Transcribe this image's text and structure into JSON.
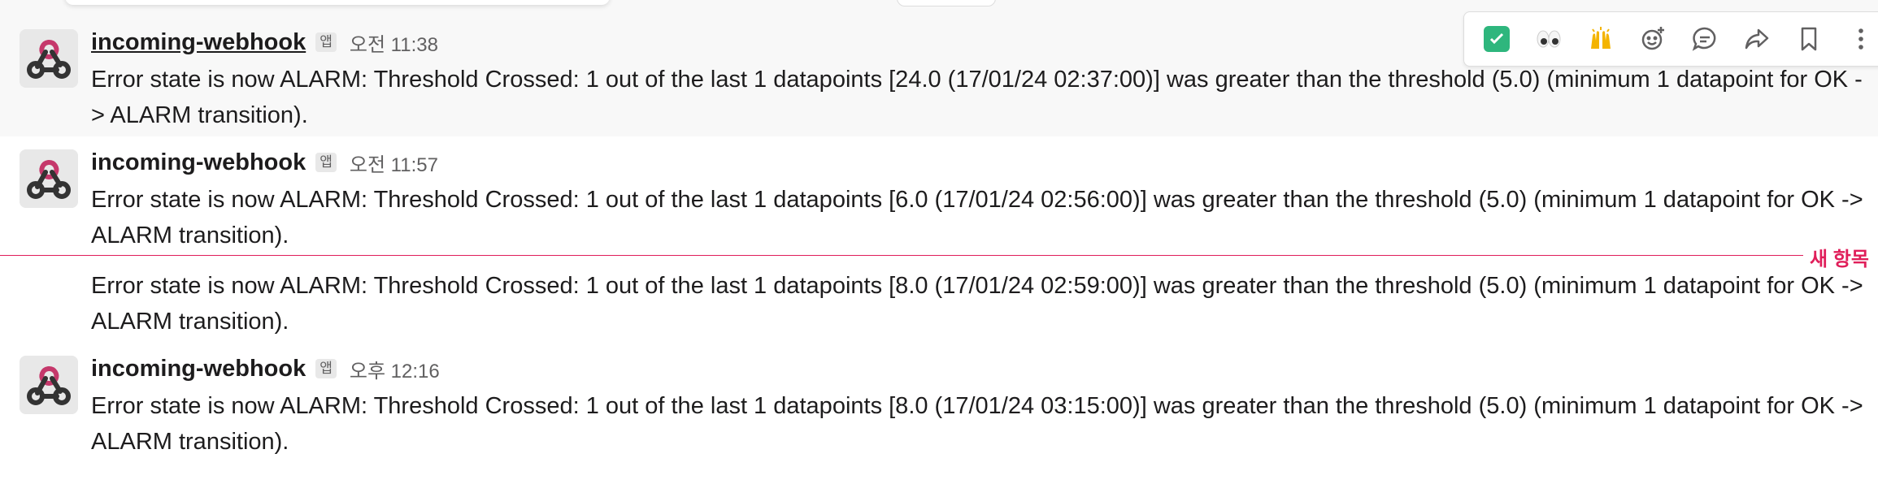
{
  "messages": [
    {
      "sender": "incoming-webhook",
      "badge": "앱",
      "time": "오전 11:38",
      "text": "Error state is now ALARM: Threshold Crossed: 1 out of the last 1 datapoints [24.0 (17/01/24 02:37:00)] was greater than the threshold (5.0) (minimum 1 datapoint for OK -> ALARM transition)."
    },
    {
      "sender": "incoming-webhook",
      "badge": "앱",
      "time": "오전 11:57",
      "text": "Error state is now ALARM: Threshold Crossed: 1 out of the last 1 datapoints [6.0 (17/01/24 02:56:00)] was greater than the threshold (5.0) (minimum 1 datapoint for OK -> ALARM transition)."
    },
    {
      "text": "Error state is now ALARM: Threshold Crossed: 1 out of the last 1 datapoints [8.0 (17/01/24 02:59:00)] was greater than the threshold (5.0) (minimum 1 datapoint for OK -> ALARM transition)."
    },
    {
      "sender": "incoming-webhook",
      "badge": "앱",
      "time": "오후 12:16",
      "text": "Error state is now ALARM: Threshold Crossed: 1 out of the last 1 datapoints [8.0 (17/01/24 03:15:00)] was greater than the threshold (5.0) (minimum 1 datapoint for OK -> ALARM transition)."
    }
  ],
  "divider": {
    "label": "새 항목",
    "color": "#e01e5a"
  },
  "toolbar": {
    "items": [
      "white-check-mark-emoji",
      "eyes-emoji",
      "raised-hands-emoji",
      "add-reaction-icon",
      "reply-in-thread-icon",
      "share-icon",
      "save-icon",
      "more-actions-icon"
    ]
  },
  "colors": {
    "hover_bg": "#f8f8f8",
    "new_divider": "#e01e5a",
    "text": "#1d1c1d",
    "muted": "#616061"
  }
}
